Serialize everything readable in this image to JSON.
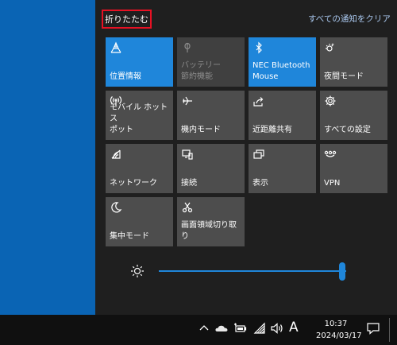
{
  "header": {
    "collapse_label": "折りたたむ",
    "clear_all_label": "すべての通知をクリア"
  },
  "tiles": [
    {
      "label": "位置情報",
      "icon": "location-icon",
      "state": "active"
    },
    {
      "label": "バッテリー\n節約機能",
      "icon": "battery-saver-icon",
      "state": "disabled"
    },
    {
      "label": "NEC Bluetooth\nMouse",
      "icon": "bluetooth-icon",
      "state": "active"
    },
    {
      "label": "夜間モード",
      "icon": "night-light-icon",
      "state": "normal"
    },
    {
      "label": "モバイル ホットス\nポット",
      "icon": "mobile-hotspot-icon",
      "state": "normal"
    },
    {
      "label": "機内モード",
      "icon": "airplane-icon",
      "state": "normal"
    },
    {
      "label": "近距離共有",
      "icon": "nearby-share-icon",
      "state": "normal"
    },
    {
      "label": "すべての設定",
      "icon": "settings-gear-icon",
      "state": "normal"
    },
    {
      "label": "ネットワーク",
      "icon": "network-icon",
      "state": "normal"
    },
    {
      "label": "接続",
      "icon": "connect-icon",
      "state": "normal"
    },
    {
      "label": "表示",
      "icon": "project-icon",
      "state": "normal"
    },
    {
      "label": "VPN",
      "icon": "vpn-icon",
      "state": "normal"
    },
    {
      "label": "集中モード",
      "icon": "focus-moon-icon",
      "state": "normal"
    },
    {
      "label": "画面領域切り取\nり",
      "icon": "snip-icon",
      "state": "normal"
    }
  ],
  "brightness": {
    "level": 0.98
  },
  "taskbar": {
    "ime_label": "A",
    "time": "10:37",
    "date": "2024/03/17"
  },
  "colors": {
    "accent": "#1f86da",
    "desktop": "#0a64b4",
    "highlight_border": "#e81123"
  }
}
